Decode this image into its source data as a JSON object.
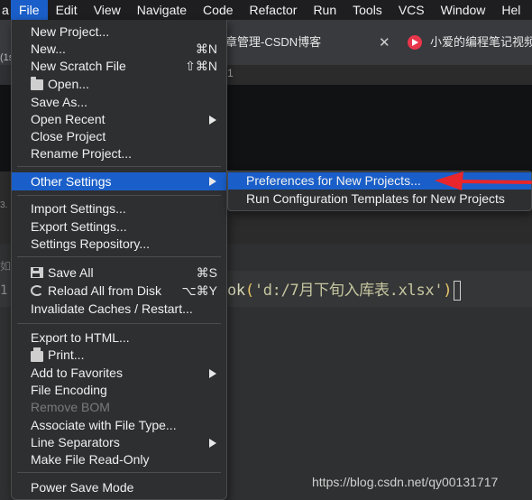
{
  "menubar": {
    "items": [
      "a",
      "File",
      "Edit",
      "View",
      "Navigate",
      "Code",
      "Refactor",
      "Run",
      "Tools",
      "VCS",
      "Window",
      "Hel"
    ]
  },
  "browser": {
    "tab1_label": "章管理-CSDN博客",
    "tab2_label": "小爱的编程笔记视频",
    "left_fragment": "(1s",
    "url_fragment": "1"
  },
  "editor": {
    "code_prefix": "ok",
    "code_open_paren": "(",
    "code_string": "'d:/7月下旬入库表.xlsx'",
    "code_close_paren": ")",
    "left_char1": "如",
    "left_char2": "1",
    "left_char3": "3."
  },
  "file_menu": {
    "new_project": "New Project...",
    "new": "New...",
    "new_shortcut": "⌘N",
    "new_scratch_file": "New Scratch File",
    "new_scratch_shortcut": "⇧⌘N",
    "open": "Open...",
    "save_as": "Save As...",
    "open_recent": "Open Recent",
    "close_project": "Close Project",
    "rename_project": "Rename Project...",
    "other_settings": "Other Settings",
    "import_settings": "Import Settings...",
    "export_settings": "Export Settings...",
    "settings_repository": "Settings Repository...",
    "save_all": "Save All",
    "save_all_shortcut": "⌘S",
    "reload_all": "Reload All from Disk",
    "reload_shortcut": "⌥⌘Y",
    "invalidate_caches": "Invalidate Caches / Restart...",
    "export_html": "Export to HTML...",
    "print": "Print...",
    "add_favorites": "Add to Favorites",
    "file_encoding": "File Encoding",
    "remove_bom": "Remove BOM",
    "associate_file_type": "Associate with File Type...",
    "line_separators": "Line Separators",
    "make_read_only": "Make File Read-Only",
    "power_save": "Power Save Mode"
  },
  "other_settings_submenu": {
    "preferences_new_projects": "Preferences for New Projects...",
    "run_config_templates": "Run Configuration Templates for New Projects"
  },
  "watermark": "https://blog.csdn.net/qy00131717",
  "colors": {
    "highlight": "#1a5fc9",
    "annotation_arrow": "#e8262b"
  }
}
